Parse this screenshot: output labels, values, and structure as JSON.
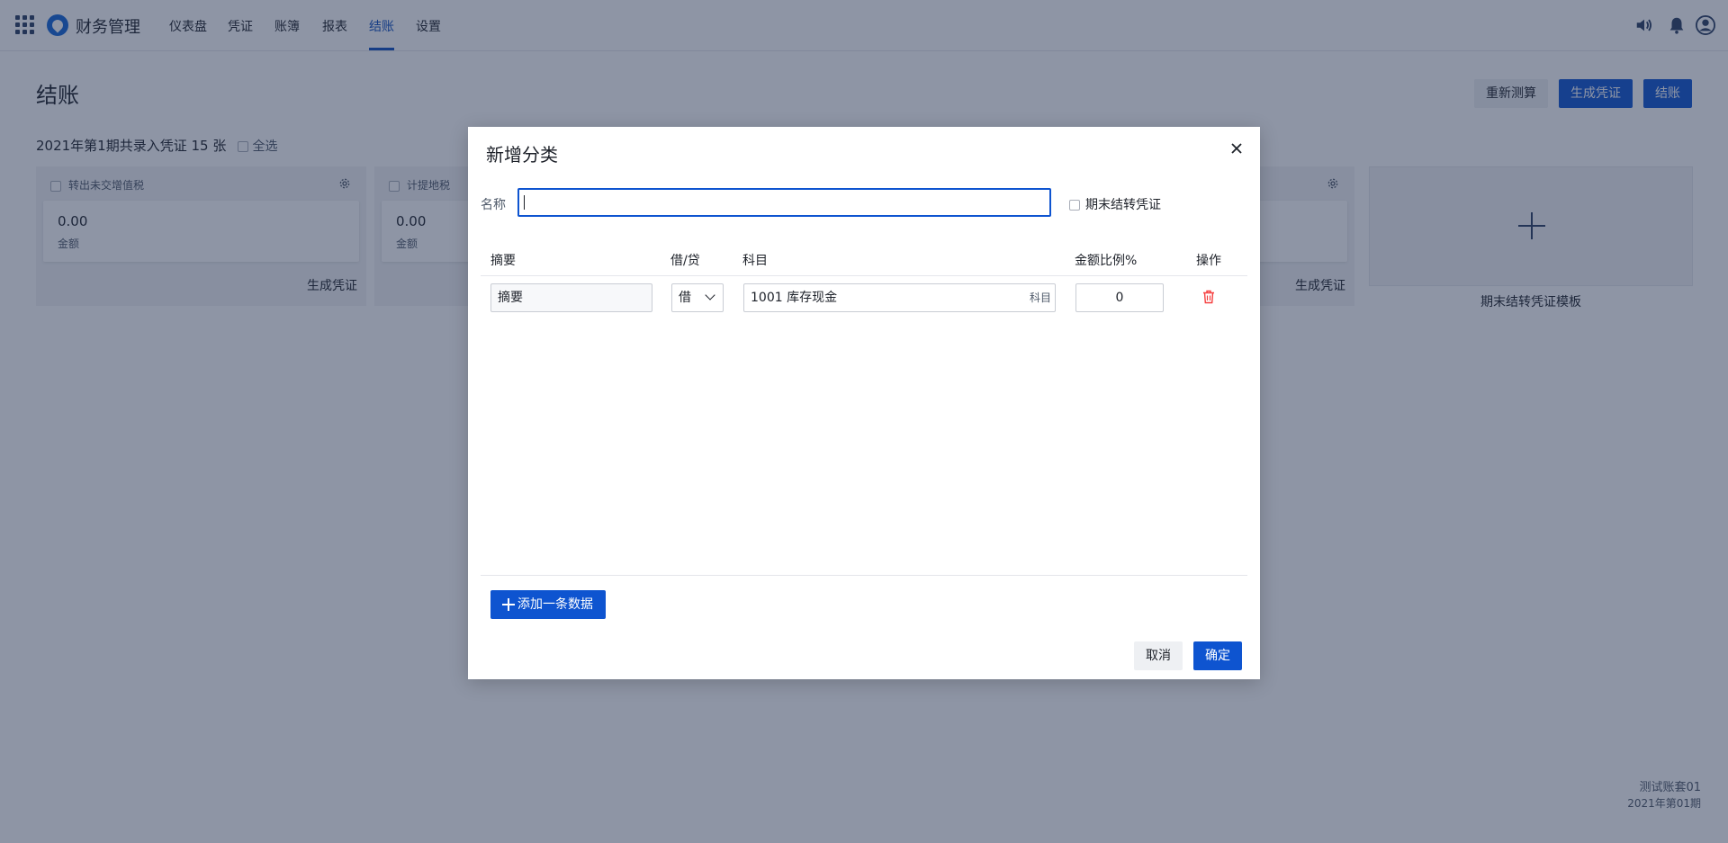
{
  "app": {
    "title": "财务管理"
  },
  "nav": {
    "items": [
      {
        "label": "仪表盘"
      },
      {
        "label": "凭证"
      },
      {
        "label": "账簿"
      },
      {
        "label": "报表"
      },
      {
        "label": "结账"
      },
      {
        "label": "设置"
      }
    ],
    "active": "结账"
  },
  "icons": {
    "apps": "apps-grid-icon",
    "logo": "app-logo-icon",
    "volume": "volume-icon",
    "notifications": "bell-icon",
    "account": "user-avatar-icon"
  },
  "page": {
    "title": "结账",
    "buttons": {
      "recalc": "重新测算",
      "generate": "生成凭证",
      "close": "结账"
    },
    "summary": "2021年第1期共录入凭证 15 张",
    "select_all": "全选",
    "cards": [
      {
        "title": "转出未交增值税",
        "amount": "0.00",
        "amount_label": "金额",
        "action": "生成凭证"
      },
      {
        "title": "计提地税",
        "amount": "0.00",
        "amount_label": "金额",
        "action": "生成凭证"
      },
      {
        "title": "",
        "amount": "",
        "amount_label": "",
        "action": "生成凭证"
      }
    ],
    "add_template_label": "期末结转凭证模板"
  },
  "footer": {
    "account_set": "测试账套01",
    "period": "2021年第01期"
  },
  "modal": {
    "title": "新增分类",
    "name_label": "名称",
    "name_value": "",
    "period_end_label": "期末结转凭证",
    "period_end_checked": false,
    "columns": {
      "summary": "摘要",
      "dc": "借/贷",
      "subject": "科目",
      "ratio": "金额比例%",
      "action": "操作"
    },
    "rows": [
      {
        "summary": "摘要",
        "dc": "借",
        "subject": "1001 库存现金",
        "subject_tag": "科目",
        "ratio": "0"
      }
    ],
    "add_row": "添加一条数据",
    "cancel": "取消",
    "ok": "确定"
  },
  "colors": {
    "primary": "#0e54d0",
    "active_nav": "#0e4fbf",
    "danger": "#f53f3f",
    "overlay": "rgba(29,44,76,0.5)"
  }
}
